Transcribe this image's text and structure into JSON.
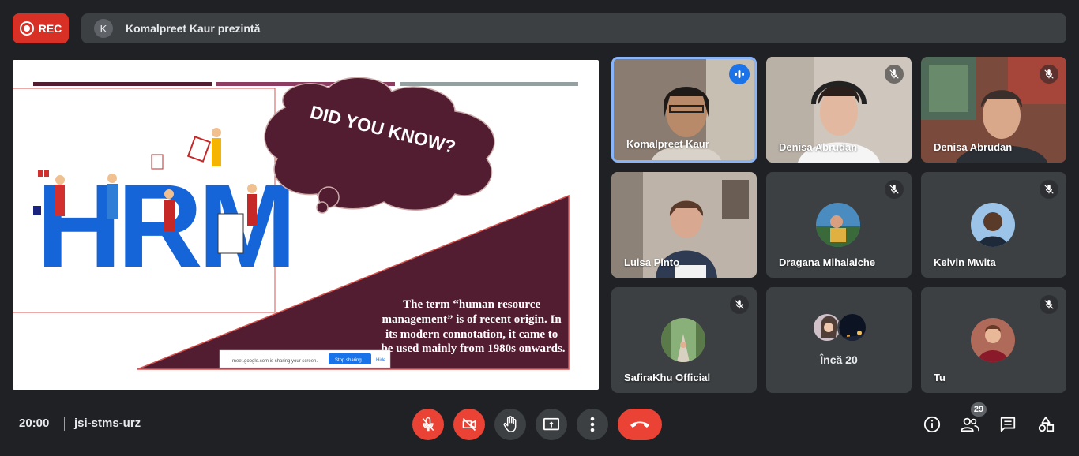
{
  "recording": {
    "label": "REC"
  },
  "presenter": {
    "initial": "K",
    "text": "Komalpreet Kaur prezintă"
  },
  "slide": {
    "bubble_text": "DID YOU KNOW?",
    "hrm_letters": "HRM",
    "body_text": [
      "The term “human resource",
      "management” is of recent origin. In",
      "its modern connotation, it came to",
      "be used mainly from 1980s onwards."
    ],
    "sharing_notice": "meet.google.com is sharing your screen.",
    "stop_sharing_label": "Stop sharing",
    "hide_label": "Hide"
  },
  "participants": [
    {
      "name": "Komalpreet Kaur",
      "speaking": true
    },
    {
      "name": "Denisa Abrudan",
      "muted": true
    },
    {
      "name": "Denisa Abrudan",
      "muted": true
    },
    {
      "name": "Luisa Pinto",
      "muted": false
    },
    {
      "name": "Dragana Mihalaiche",
      "muted": true
    },
    {
      "name": "Kelvin Mwita",
      "muted": true
    },
    {
      "name": "SafiraKhu Official",
      "muted": true
    },
    {
      "name": "Încă 20"
    },
    {
      "name": "Tu",
      "muted": true
    }
  ],
  "bottom": {
    "time": "20:00",
    "meeting_code": "jsi-stms-urz",
    "people_count": "29"
  },
  "colors": {
    "background": "#202124",
    "tile": "#3c4043",
    "danger": "#ea4335",
    "accent": "#8ab4f8",
    "slide_maroon": "#521d31"
  },
  "icons": [
    "record-icon",
    "mic-off-icon",
    "camera-off-icon",
    "raise-hand-icon",
    "present-icon",
    "more-icon",
    "hangup-icon",
    "info-icon",
    "people-icon",
    "chat-icon",
    "activities-icon",
    "audio-wave-icon"
  ]
}
